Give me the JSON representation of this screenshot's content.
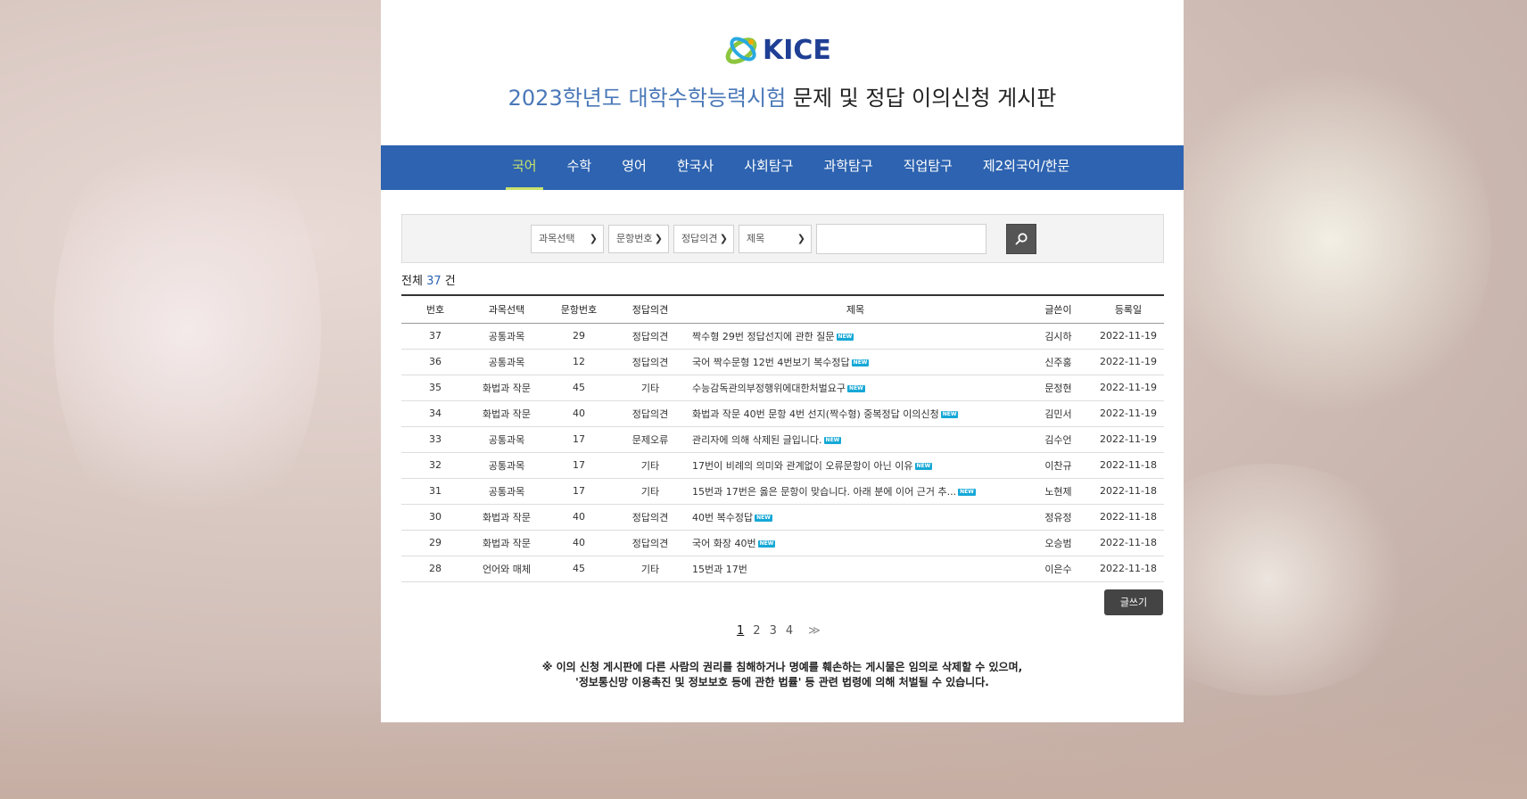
{
  "header": {
    "logo_text": "KICE",
    "title_accent": "2023학년도 대학수학능력시험",
    "title_rest": " 문제 및 정답 이의신청 게시판"
  },
  "nav": {
    "items": [
      "국어",
      "수학",
      "영어",
      "한국사",
      "사회탐구",
      "과학탐구",
      "직업탐구",
      "제2외국어/한문"
    ],
    "active_index": 0
  },
  "search": {
    "subject_select": "과목선택",
    "question_select": "문항번호",
    "opinion_select": "정답의견",
    "field_select": "제목",
    "query": ""
  },
  "summary": {
    "prefix": "전체",
    "count": "37",
    "suffix": "건"
  },
  "table": {
    "headers": [
      "번호",
      "과목선택",
      "문항번호",
      "정답의견",
      "제목",
      "글쓴이",
      "등록일"
    ],
    "rows": [
      {
        "no": "37",
        "subject": "공통과목",
        "question": "29",
        "opinion": "정답의견",
        "title": "짝수형 29번 정답선지에 관한 질문",
        "new": true,
        "author": "김시하",
        "date": "2022-11-19"
      },
      {
        "no": "36",
        "subject": "공통과목",
        "question": "12",
        "opinion": "정답의견",
        "title": "국어 짝수문형 12번 4번보기 복수정답",
        "new": true,
        "author": "신주홍",
        "date": "2022-11-19"
      },
      {
        "no": "35",
        "subject": "화법과 작문",
        "question": "45",
        "opinion": "기타",
        "title": "수능감독관의부정행위에대한처벌요구",
        "new": true,
        "author": "문정현",
        "date": "2022-11-19"
      },
      {
        "no": "34",
        "subject": "화법과 작문",
        "question": "40",
        "opinion": "정답의견",
        "title": "화법과 작문 40번 문항 4번 선지(짝수형) 중복정답 이의신청",
        "new": true,
        "author": "김민서",
        "date": "2022-11-19"
      },
      {
        "no": "33",
        "subject": "공통과목",
        "question": "17",
        "opinion": "문제오류",
        "title": "관리자에 의해 삭제된 글입니다.",
        "new": true,
        "author": "김수언",
        "date": "2022-11-19"
      },
      {
        "no": "32",
        "subject": "공통과목",
        "question": "17",
        "opinion": "기타",
        "title": "17번이 비례의 의미와 관계없이 오류문항이 아닌 이유",
        "new": true,
        "author": "이찬규",
        "date": "2022-11-18"
      },
      {
        "no": "31",
        "subject": "공통과목",
        "question": "17",
        "opinion": "기타",
        "title": "15번과 17번은 옳은 문항이 맞습니다. 아래 분에 이어 근거 추...",
        "new": true,
        "author": "노현제",
        "date": "2022-11-18"
      },
      {
        "no": "30",
        "subject": "화법과 작문",
        "question": "40",
        "opinion": "정답의견",
        "title": "40번 복수정답",
        "new": true,
        "author": "정유정",
        "date": "2022-11-18"
      },
      {
        "no": "29",
        "subject": "화법과 작문",
        "question": "40",
        "opinion": "정답의견",
        "title": "국어 화장 40번",
        "new": true,
        "author": "오승범",
        "date": "2022-11-18"
      },
      {
        "no": "28",
        "subject": "언어와 매체",
        "question": "45",
        "opinion": "기타",
        "title": "15번과 17번",
        "new": false,
        "author": "이은수",
        "date": "2022-11-18"
      }
    ],
    "new_label": "NEW"
  },
  "write_button": "글쓰기",
  "pagination": {
    "pages": [
      "1",
      "2",
      "3",
      "4"
    ],
    "current": "1",
    "next": "≫"
  },
  "notice": {
    "line1": "※ 이의 신청 게시판에 다른 사람의 권리를 침해하거나 명예를 훼손하는 게시물은 임의로 삭제할 수 있으며,",
    "line2": "'정보통신망 이용촉진 및 정보보호 등에 관한 법률' 등 관련 법령에 의해 처벌될 수 있습니다."
  },
  "colors": {
    "nav_bg": "#2d63b0",
    "nav_active": "#c8e26c",
    "title_accent": "#4a78b8",
    "new_badge": "#16a8d6"
  }
}
